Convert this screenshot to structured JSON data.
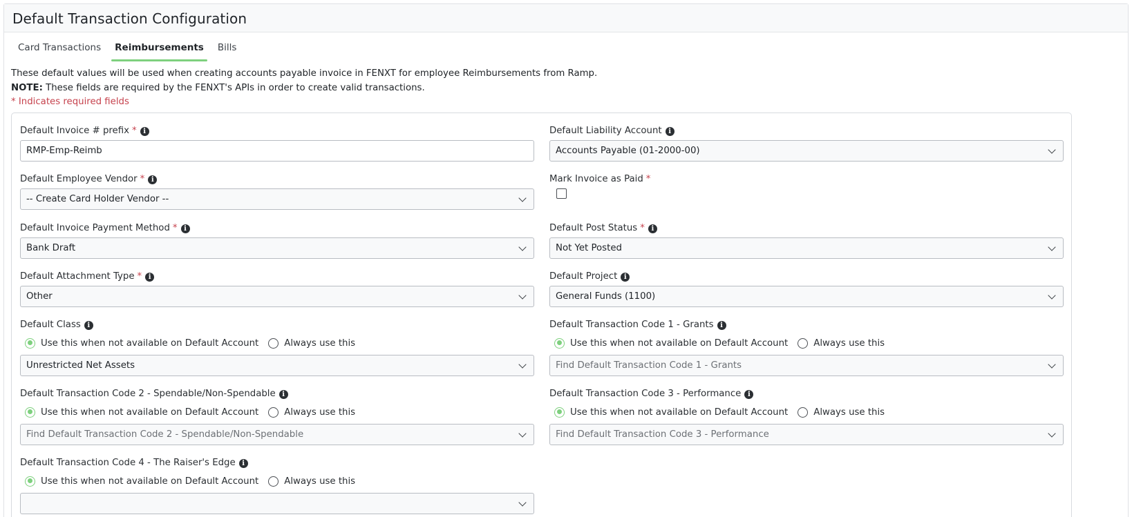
{
  "header": {
    "title": "Default Transaction Configuration"
  },
  "tabs": [
    {
      "label": "Card Transactions",
      "active": false
    },
    {
      "label": "Reimbursements",
      "active": true
    },
    {
      "label": "Bills",
      "active": false
    }
  ],
  "intro": {
    "line1": "These default values will be used when creating accounts payable invoice in FENXT for employee Reimbursements from Ramp.",
    "note_label": "NOTE:",
    "note_text": " These fields are required by the FENXT's APIs in order to create valid transactions.",
    "required_hint": "* Indicates required fields"
  },
  "required_marker": "*",
  "radio_options": {
    "when_unavailable": "Use this when not available on Default Account",
    "always": "Always use this"
  },
  "fields": {
    "invoice_prefix": {
      "label": "Default Invoice # prefix",
      "value": "RMP-Emp-Reimb"
    },
    "liability_account": {
      "label": "Default Liability Account",
      "value": "Accounts Payable (01-2000-00)"
    },
    "employee_vendor": {
      "label": "Default Employee Vendor",
      "value": "-- Create Card Holder Vendor --"
    },
    "mark_paid": {
      "label": "Mark Invoice as Paid",
      "checked": false
    },
    "payment_method": {
      "label": "Default Invoice Payment Method",
      "value": "Bank Draft"
    },
    "post_status": {
      "label": "Default Post Status",
      "value": "Not Yet Posted"
    },
    "attachment_type": {
      "label": "Default Attachment Type",
      "value": "Other"
    },
    "project": {
      "label": "Default Project",
      "value": "General Funds (1100)"
    },
    "class": {
      "label": "Default Class",
      "value": "Unrestricted Net Assets"
    },
    "code1": {
      "label": "Default Transaction Code 1 - Grants",
      "placeholder": "Find Default Transaction Code 1 - Grants"
    },
    "code2": {
      "label": "Default Transaction Code 2 - Spendable/Non-Spendable",
      "placeholder": "Find Default Transaction Code 2 - Spendable/Non-Spendable"
    },
    "code3": {
      "label": "Default Transaction Code 3 - Performance",
      "placeholder": "Find Default Transaction Code 3 - Performance"
    },
    "code4": {
      "label": "Default Transaction Code 4 - The Raiser's Edge"
    }
  },
  "colors": {
    "accent_green": "#7ed07e",
    "required_red": "#c6424d"
  },
  "icons": {
    "info": "info-circle-icon",
    "dropdown": "chevron-down-icon"
  }
}
